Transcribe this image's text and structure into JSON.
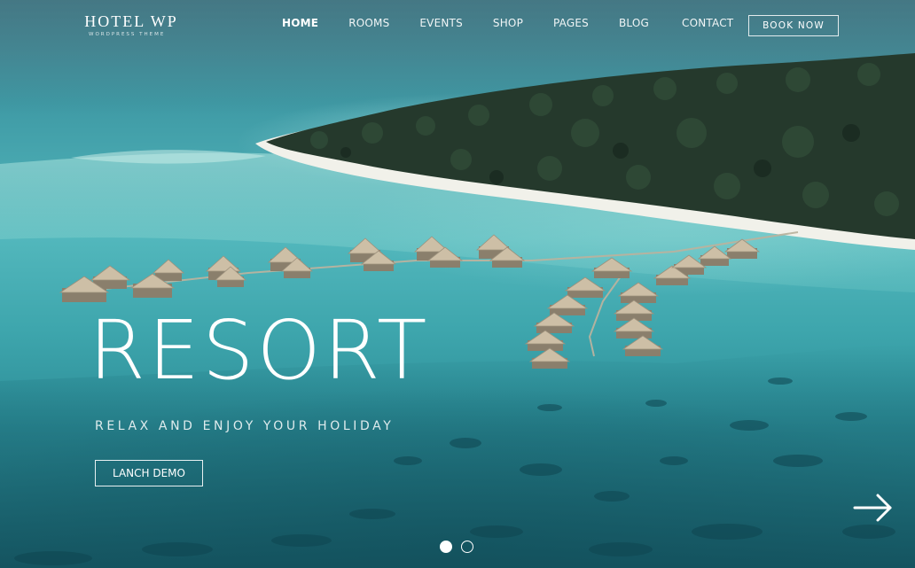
{
  "brand": {
    "name": "HOTEL WP",
    "tagline": "WORDPRESS THEME"
  },
  "nav": {
    "items": [
      {
        "label": "HOME",
        "active": true
      },
      {
        "label": "ROOMS",
        "active": false
      },
      {
        "label": "EVENTS",
        "active": false
      },
      {
        "label": "SHOP",
        "active": false
      },
      {
        "label": "PAGES",
        "active": false
      },
      {
        "label": "BLOG",
        "active": false
      },
      {
        "label": "CONTACT",
        "active": false
      }
    ],
    "book_now": "BOOK NOW"
  },
  "hero": {
    "title": "RESORT",
    "subtitle": "RELAX AND ENJOY YOUR HOLIDAY",
    "cta": "LANCH DEMO",
    "next_icon": "arrow-right-icon"
  },
  "slider": {
    "slide_count": 2,
    "active_slide": 1
  },
  "colors": {
    "text": "#ffffff",
    "water_light": "#52b7bc",
    "water_deep": "#1f6f7b",
    "foliage": "#25392c",
    "sand": "#f1f1ea",
    "roof": "#cdbfa6"
  }
}
